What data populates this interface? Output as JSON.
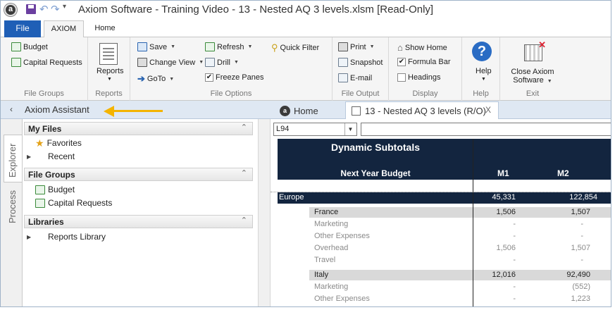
{
  "window": {
    "title": "Axiom Software - Training Video - 13 - Nested AQ 3 levels.xlsm [Read-Only]"
  },
  "ribbon_tabs": [
    "File",
    "AXIOM",
    "Home"
  ],
  "ribbon": {
    "file_groups": {
      "items": [
        "Budget",
        "Capital Requests"
      ],
      "label": "File Groups"
    },
    "reports": {
      "button": "Reports",
      "label": "Reports"
    },
    "file_options": {
      "save": "Save",
      "change_view": "Change View",
      "goto": "GoTo",
      "refresh": "Refresh",
      "drill": "Drill",
      "freeze_panes": "Freeze Panes",
      "quick_filter": "Quick Filter",
      "label": "File Options"
    },
    "file_output": {
      "print": "Print",
      "snapshot": "Snapshot",
      "email": "E-mail",
      "label": "File Output"
    },
    "display": {
      "show_home": "Show Home",
      "formula_bar": "Formula Bar",
      "headings": "Headings",
      "label": "Display"
    },
    "help": {
      "button": "Help",
      "label": "Help"
    },
    "exit": {
      "close_line1": "Close Axiom",
      "close_line2": "Software",
      "label": "Exit"
    }
  },
  "assistant": {
    "title": "Axiom Assistant"
  },
  "doc_tabs": {
    "home": "Home",
    "active": "13 - Nested AQ 3 levels (R/O)",
    "close": "X"
  },
  "side_tabs": [
    "Explorer",
    "Process"
  ],
  "explorer": {
    "my_files": {
      "header": "My Files",
      "items": [
        "Favorites",
        "Recent"
      ]
    },
    "file_groups": {
      "header": "File Groups",
      "items": [
        "Budget",
        "Capital Requests"
      ]
    },
    "libraries": {
      "header": "Libraries",
      "items": [
        "Reports Library"
      ]
    }
  },
  "sheet": {
    "namebox": "L94",
    "header_title": "Dynamic Subtotals",
    "header_sub": "Next Year Budget",
    "columns": [
      "M1",
      "M2"
    ],
    "rows": [
      {
        "type": "region",
        "label": "Europe",
        "m1": "45,331",
        "m2": "122,854"
      },
      {
        "type": "country",
        "label": "France",
        "m1": "1,506",
        "m2": "1,507"
      },
      {
        "type": "dept",
        "label": "Marketing",
        "m1": "-",
        "m2": "-"
      },
      {
        "type": "dept",
        "label": "Other Expenses",
        "m1": "-",
        "m2": "-"
      },
      {
        "type": "dept",
        "label": "Overhead",
        "m1": "1,506",
        "m2": "1,507"
      },
      {
        "type": "dept",
        "label": "Travel",
        "m1": "-",
        "m2": "-"
      },
      {
        "type": "country",
        "label": "Italy",
        "m1": "12,016",
        "m2": "92,490"
      },
      {
        "type": "dept",
        "label": "Marketing",
        "m1": "-",
        "m2": "(552)"
      },
      {
        "type": "dept",
        "label": "Other Expenses",
        "m1": "-",
        "m2": "1,223"
      }
    ]
  },
  "colors": {
    "accent": "#1f5fb6",
    "header_navy": "#13253f",
    "arrow": "#f4b400",
    "assistant_bar": "#dfe8f3"
  }
}
